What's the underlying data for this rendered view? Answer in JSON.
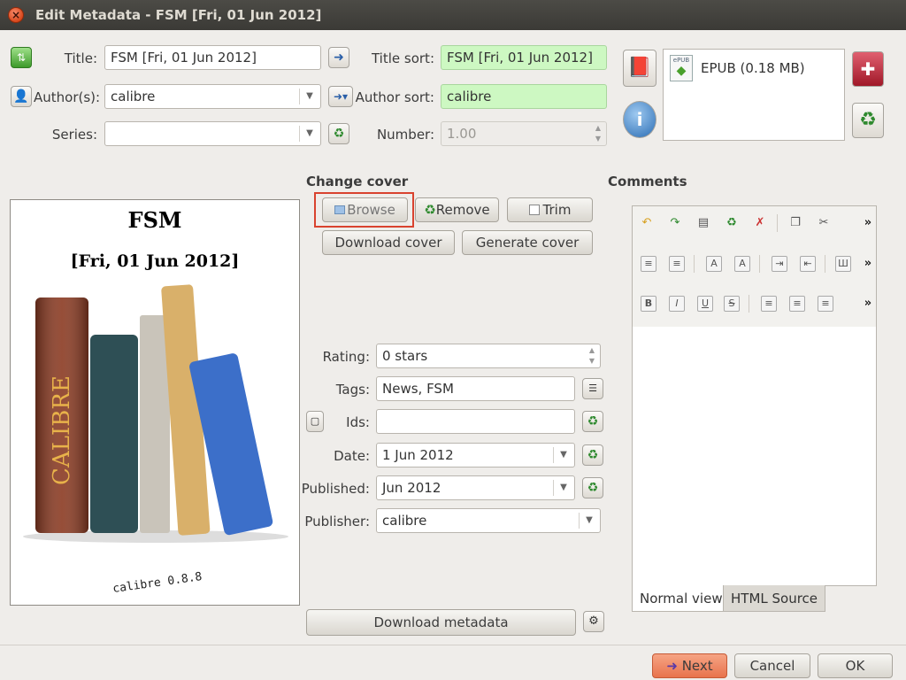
{
  "window": {
    "title": "Edit Metadata - FSM [Fri, 01 Jun 2012]",
    "close": "×"
  },
  "fields": {
    "title": {
      "label": "Title:",
      "value": "FSM [Fri, 01 Jun 2012]"
    },
    "title_sort": {
      "label": "Title sort:",
      "value": "FSM [Fri, 01 Jun 2012]"
    },
    "authors": {
      "label": "Author(s):",
      "value": "calibre"
    },
    "author_sort": {
      "label": "Author sort:",
      "value": "calibre"
    },
    "series": {
      "label": "Series:",
      "value": ""
    },
    "number": {
      "label": "Number:",
      "value": "1.00"
    },
    "rating": {
      "label": "Rating:",
      "value": "0 stars"
    },
    "tags": {
      "label": "Tags:",
      "value": "News, FSM"
    },
    "ids": {
      "label": "Ids:",
      "value": ""
    },
    "date": {
      "label": "Date:",
      "value": "1 Jun 2012"
    },
    "published": {
      "label": "Published:",
      "value": "Jun 2012"
    },
    "publisher": {
      "label": "Publisher:",
      "value": "calibre"
    }
  },
  "formats": {
    "items": [
      {
        "badge": "ePUB",
        "label": "EPUB (0.18 MB)"
      }
    ]
  },
  "cover": {
    "heading": "Change cover",
    "browse": "Browse",
    "remove": "Remove",
    "trim": "Trim",
    "download": "Download cover",
    "generate": "Generate cover",
    "preview_title": "FSM",
    "preview_subtitle": "[Fri, 01 Jun 2012]",
    "preview_footer": "calibre 0.8.8",
    "spine_text": "CALIBRE"
  },
  "comments": {
    "heading": "Comments",
    "tab_normal": "Normal view",
    "tab_html": "HTML Source",
    "more": "»"
  },
  "buttons": {
    "download_metadata": "Download metadata",
    "next": "Next",
    "cancel": "Cancel",
    "ok": "OK"
  },
  "colors": {
    "sort_field_bg": "#cdf8c2",
    "highlight": "#d9432f",
    "next_button": "#e8734d"
  }
}
